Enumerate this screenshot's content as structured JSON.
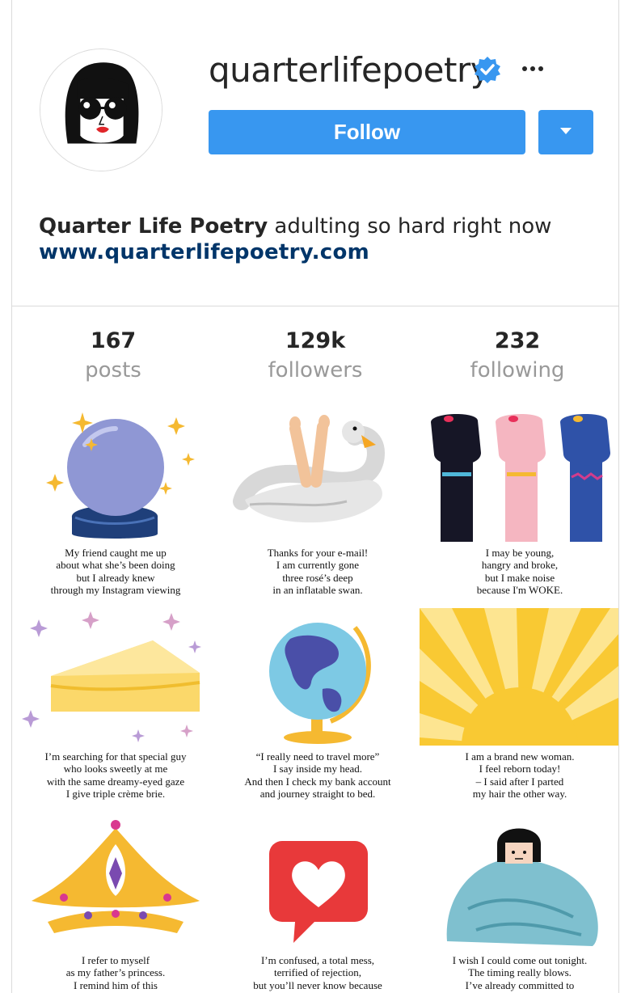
{
  "profile": {
    "username": "quarterlifepoetry",
    "verified": true,
    "verified_icon": "verified-badge-icon",
    "more_icon": "more-options-icon",
    "follow_label": "Follow",
    "dropdown_icon": "caret-down-icon",
    "bio_name": "Quarter Life Poetry",
    "bio_text": " adulting so hard right now",
    "website": "www.quarterlifepoetry.com",
    "accent_color": "#3897f0",
    "link_color": "#003569"
  },
  "stats": [
    {
      "value": "167",
      "label": "posts"
    },
    {
      "value": "129k",
      "label": "followers"
    },
    {
      "value": "232",
      "label": "following"
    }
  ],
  "posts": [
    {
      "art": "crystal-ball",
      "caption": [
        "My friend caught me up",
        "about what she’s been doing",
        "but I already knew",
        "through my Instagram viewing"
      ]
    },
    {
      "art": "swan-float",
      "caption": [
        "Thanks for your e-mail!",
        "I am currently gone",
        "three rosé’s deep",
        "in an inflatable swan."
      ]
    },
    {
      "art": "raised-fists",
      "caption": [
        "I may be young,",
        "hangry and broke,",
        "but I make noise",
        "because I'm WOKE."
      ]
    },
    {
      "art": "cheese-brie",
      "caption": [
        "I’m searching for that special guy",
        "who looks sweetly at me",
        "with the same dreamy-eyed gaze",
        "I give triple crème brie."
      ]
    },
    {
      "art": "globe",
      "caption": [
        "“I really need to travel more”",
        "I say inside my head.",
        "And then I check my bank account",
        "and journey straight to bed."
      ]
    },
    {
      "art": "sunrise",
      "caption": [
        "I am a brand new woman.",
        "I feel reborn today!",
        "– I said after I parted",
        "my hair the other way."
      ]
    },
    {
      "art": "tiara",
      "caption": [
        "I refer to myself",
        "as my father’s princess.",
        "I remind him of this"
      ]
    },
    {
      "art": "heart-bubble",
      "caption": [
        "I’m confused, a total mess,",
        "terrified of rejection,",
        "but you’ll never know because"
      ]
    },
    {
      "art": "blanket-girl",
      "caption": [
        "I wish I could come out tonight.",
        "The timing really blows.",
        "I’ve already committed to"
      ]
    }
  ]
}
